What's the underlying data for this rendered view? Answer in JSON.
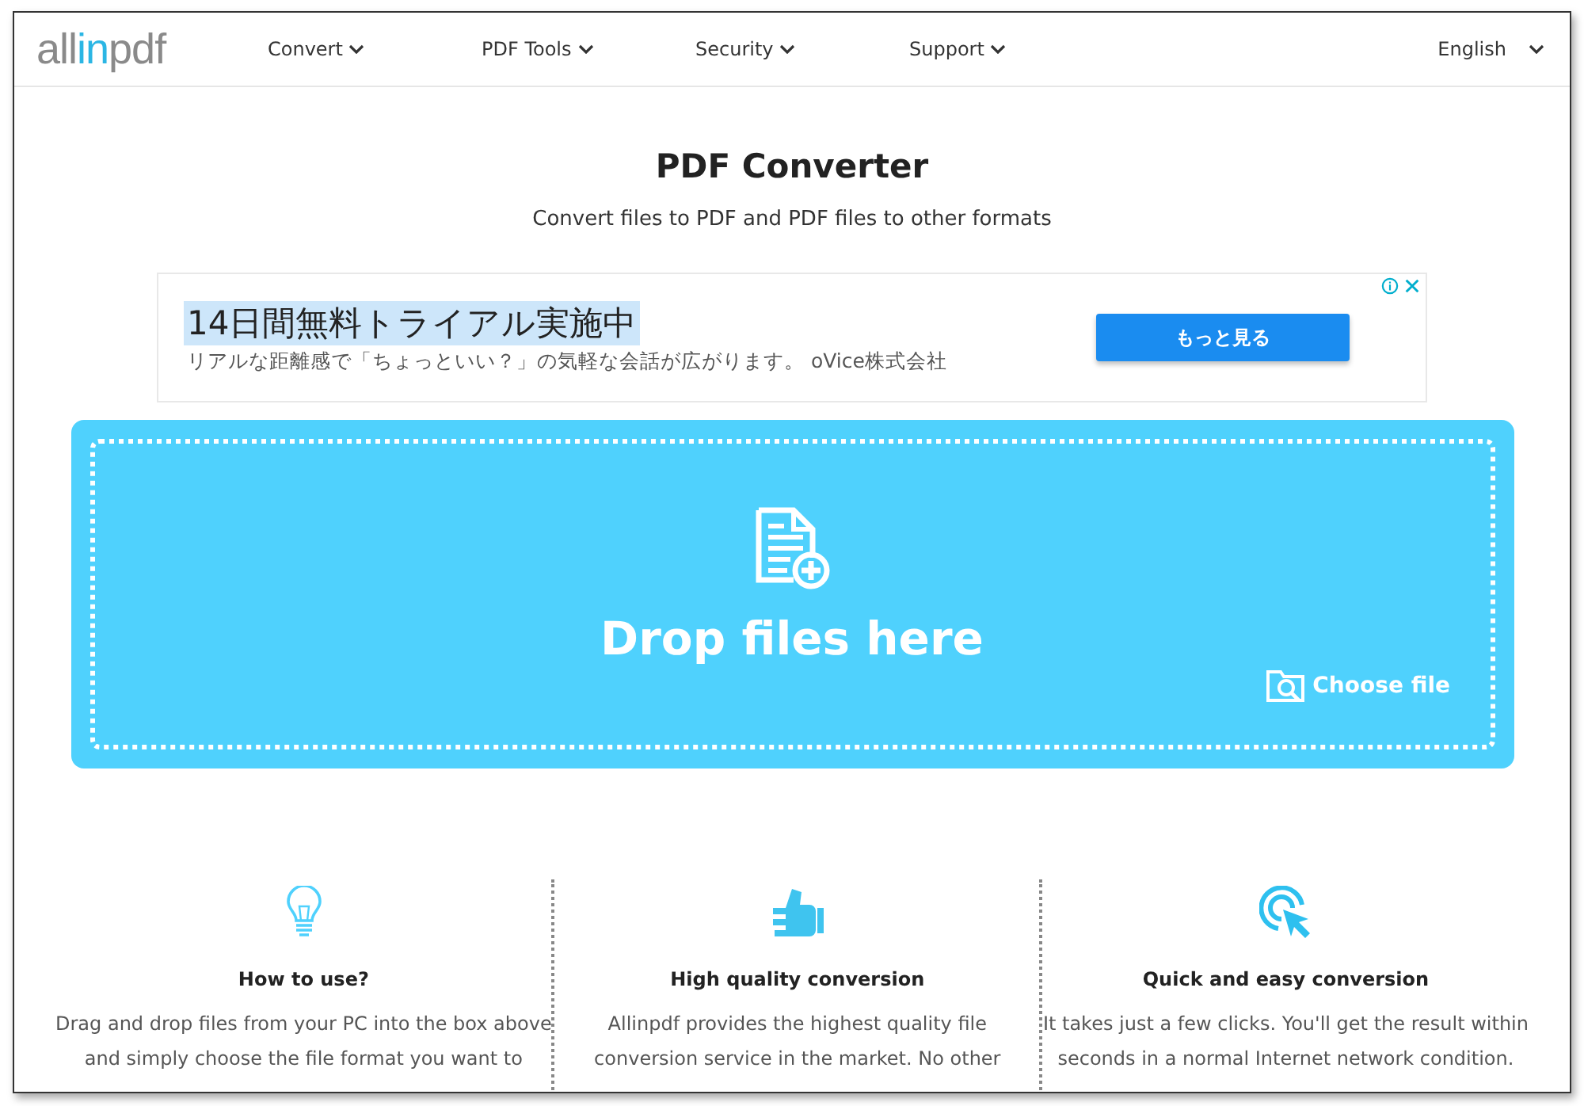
{
  "header": {
    "logo": {
      "part_1": "all",
      "part_2": "in",
      "part_3": "pdf"
    },
    "nav": [
      {
        "label": "Convert"
      },
      {
        "label": "PDF Tools"
      },
      {
        "label": "Security"
      },
      {
        "label": "Support"
      }
    ],
    "language": "English"
  },
  "hero": {
    "title": "PDF Converter",
    "subtitle": "Convert files to PDF and PDF files to other formats"
  },
  "ad": {
    "headline": "14日間無料トライアル実施中",
    "text": "リアルな距離感で「ちょっといい？」の気軽な会話が広がります。 oVice株式会社",
    "button": "もっと見る"
  },
  "dropzone": {
    "label": "Drop files here",
    "choose": "Choose file"
  },
  "features": [
    {
      "kind": "bulb",
      "title": "How to use?",
      "lines": [
        "Drag and drop files from your PC into the box above",
        "and simply choose the file format you want to"
      ]
    },
    {
      "kind": "thumb",
      "title": "High quality conversion",
      "lines": [
        "Allinpdf provides the highest quality file",
        "conversion service in the market. No other"
      ]
    },
    {
      "kind": "click",
      "title": "Quick and easy conversion",
      "lines": [
        "It takes just a few clicks. You'll get the result within",
        "seconds in a normal Internet network condition."
      ]
    }
  ]
}
